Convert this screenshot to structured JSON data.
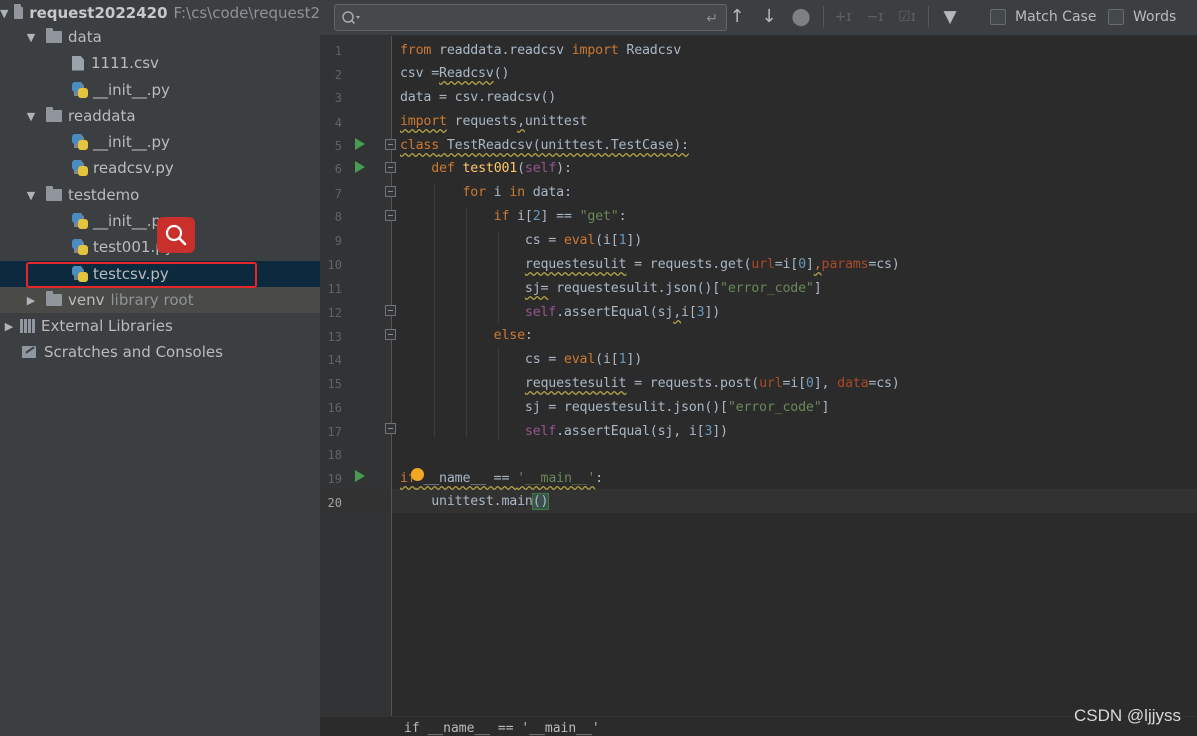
{
  "project_tree": {
    "root": {
      "name": "request2022420",
      "path": "F:\\cs\\code\\request2"
    },
    "items": [
      {
        "label": "data"
      },
      {
        "label": "1111.csv"
      },
      {
        "label": "__init__.py"
      },
      {
        "label": "readdata"
      },
      {
        "label": "__init__.py"
      },
      {
        "label": "readcsv.py"
      },
      {
        "label": "testdemo"
      },
      {
        "label": "__init__.py"
      },
      {
        "label": "test001.py"
      },
      {
        "label": "testcsv.py"
      },
      {
        "label": "venv",
        "hint": "library root"
      },
      {
        "label": "External Libraries"
      },
      {
        "label": "Scratches and Consoles"
      }
    ]
  },
  "find_bar": {
    "query": "",
    "match_case_label": "Match Case",
    "words_label": "Words"
  },
  "editor": {
    "current_line": 20,
    "line_numbers": [
      "1",
      "2",
      "3",
      "4",
      "5",
      "6",
      "7",
      "8",
      "9",
      "10",
      "11",
      "12",
      "13",
      "14",
      "15",
      "16",
      "17",
      "18",
      "19",
      "20"
    ],
    "breadcrumb": "if __name__ == '__main__'"
  },
  "watermark": "CSDN @ljjyss"
}
